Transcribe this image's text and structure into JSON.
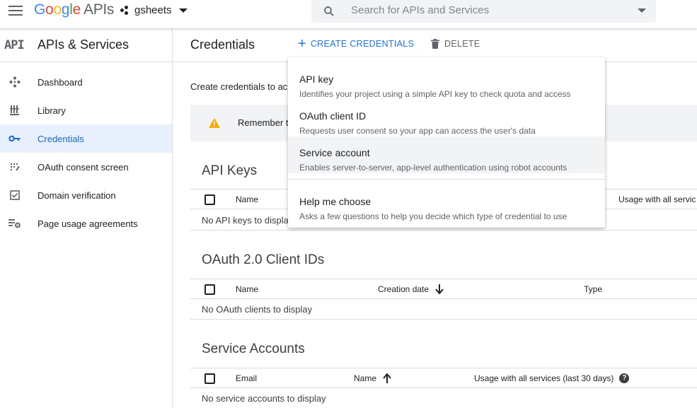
{
  "topbar": {
    "logo": {
      "g": "G",
      "o1": "o",
      "o2": "o",
      "g2": "g",
      "l": "l",
      "e": "e",
      "apis": "APIs"
    },
    "project": "gsheets",
    "search_placeholder": "Search for APIs and Services"
  },
  "sidebar": {
    "api_mark": "API",
    "title": "APIs & Services",
    "items": [
      {
        "label": "Dashboard",
        "icon": "dashboard-icon"
      },
      {
        "label": "Library",
        "icon": "library-icon"
      },
      {
        "label": "Credentials",
        "icon": "key-icon",
        "active": true
      },
      {
        "label": "OAuth consent screen",
        "icon": "consent-icon"
      },
      {
        "label": "Domain verification",
        "icon": "checkbox-icon"
      },
      {
        "label": "Page usage agreements",
        "icon": "settings-list-icon"
      }
    ]
  },
  "header": {
    "title": "Credentials",
    "create_label": "CREATE CREDENTIALS",
    "delete_label": "DELETE"
  },
  "content": {
    "intro": "Create credentials to access your enabled APIs",
    "alert": "Remember t",
    "api_keys": {
      "title": "API Keys",
      "columns": [
        "Name",
        "Usage with all servic"
      ],
      "empty": "No API keys to display"
    },
    "oauth": {
      "title": "OAuth 2.0 Client IDs",
      "columns": [
        "Name",
        "Creation date",
        "Type"
      ],
      "empty": "No OAuth clients to display"
    },
    "service_accounts": {
      "title": "Service Accounts",
      "columns": [
        "Email",
        "Name",
        "Usage with all services (last 30 days)"
      ],
      "empty": "No service accounts to display"
    }
  },
  "menu": {
    "items": [
      {
        "title": "API key",
        "desc": "Identifies your project using a simple API key to check quota and access"
      },
      {
        "title": "OAuth client ID",
        "desc": "Requests user consent so your app can access the user's data"
      },
      {
        "title": "Service account",
        "desc": "Enables server-to-server, app-level authentication using robot accounts",
        "highlighted": true
      },
      {
        "title": "Help me choose",
        "desc": "Asks a few questions to help you decide which type of credential to use"
      }
    ]
  },
  "colors": {
    "accent": "#1a73e8",
    "active_bg": "#e8f0fe",
    "warning": "#f9ab00"
  }
}
